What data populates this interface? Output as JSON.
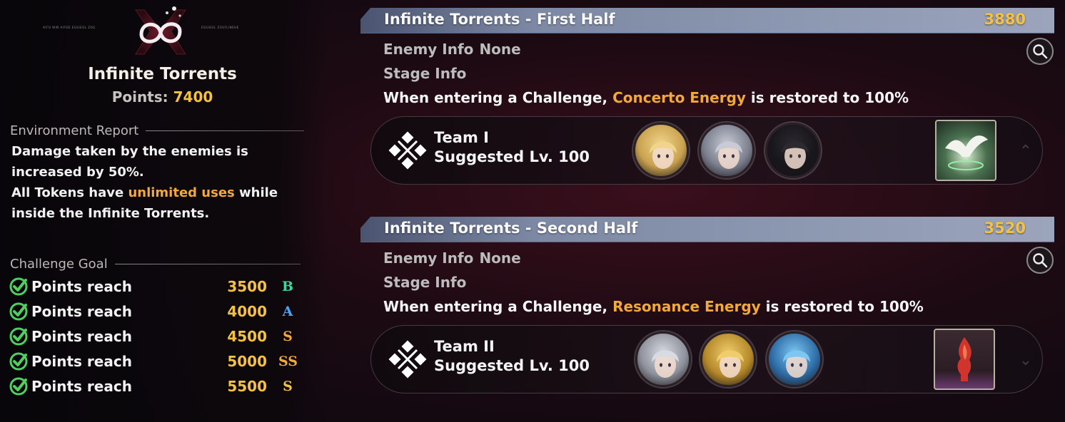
{
  "mode": {
    "title": "Infinite Torrents",
    "points_label": "Points:",
    "points_value": "7400",
    "emblem_caption_left": "AIFO WIN AIFOE  ESGIEOL ZOG",
    "emblem_caption_right": "ESGIEOL ZOSFLINEHE"
  },
  "environment": {
    "heading": "Environment Report",
    "text_part1": "Damage taken by the enemies is increased by 50%.",
    "text_part2_pre": "All Tokens have ",
    "text_part2_highlight": "unlimited uses",
    "text_part2_post": " while inside the Infinite Torrents."
  },
  "challenge_goal": {
    "heading": "Challenge Goal",
    "goals": [
      {
        "label": "Points reach",
        "value": "3500",
        "rank": "B",
        "rank_color": "#3fd4a0"
      },
      {
        "label": "Points reach",
        "value": "4000",
        "rank": "A",
        "rank_color": "#4fa3f0"
      },
      {
        "label": "Points reach",
        "value": "4500",
        "rank": "S",
        "rank_color": "#f0a93a"
      },
      {
        "label": "Points reach",
        "value": "5000",
        "rank": "SS",
        "rank_color": "#f0a93a"
      },
      {
        "label": "Points reach",
        "value": "5500",
        "rank": "S",
        "rank_color": "#f5c143"
      }
    ]
  },
  "stages": [
    {
      "name": "Infinite Torrents - First Half",
      "points": "3880",
      "enemy_info_label": "Enemy Info",
      "enemy_info_value": "None",
      "stage_info_label": "Stage Info",
      "desc_pre": "When entering a Challenge, ",
      "desc_highlight": "Concerto Energy",
      "desc_post": " is restored to 100%",
      "team_name": "Team I",
      "suggested_level": "Suggested Lv. 100",
      "avatars": [
        "blonde-character-avatar",
        "silver-masked-character-avatar",
        "dark-haired-character-avatar"
      ],
      "echo": "white-bird-echo-icon"
    },
    {
      "name": "Infinite Torrents - Second Half",
      "points": "3520",
      "enemy_info_label": "Enemy Info",
      "enemy_info_value": "None",
      "stage_info_label": "Stage Info",
      "desc_pre": "When entering a Challenge, ",
      "desc_highlight": "Resonance Energy",
      "desc_post": " is restored to 100%",
      "team_name": "Team II",
      "suggested_level": "Suggested Lv. 100",
      "avatars": [
        "white-haired-character-avatar",
        "blonde-hat-character-avatar",
        "blue-haired-character-avatar"
      ],
      "echo": "red-flame-echo-icon"
    }
  ],
  "colors": {
    "accent_gold": "#f5c143",
    "highlight_orange": "#f0a93a",
    "stage_bar": "#8f9ab3"
  }
}
